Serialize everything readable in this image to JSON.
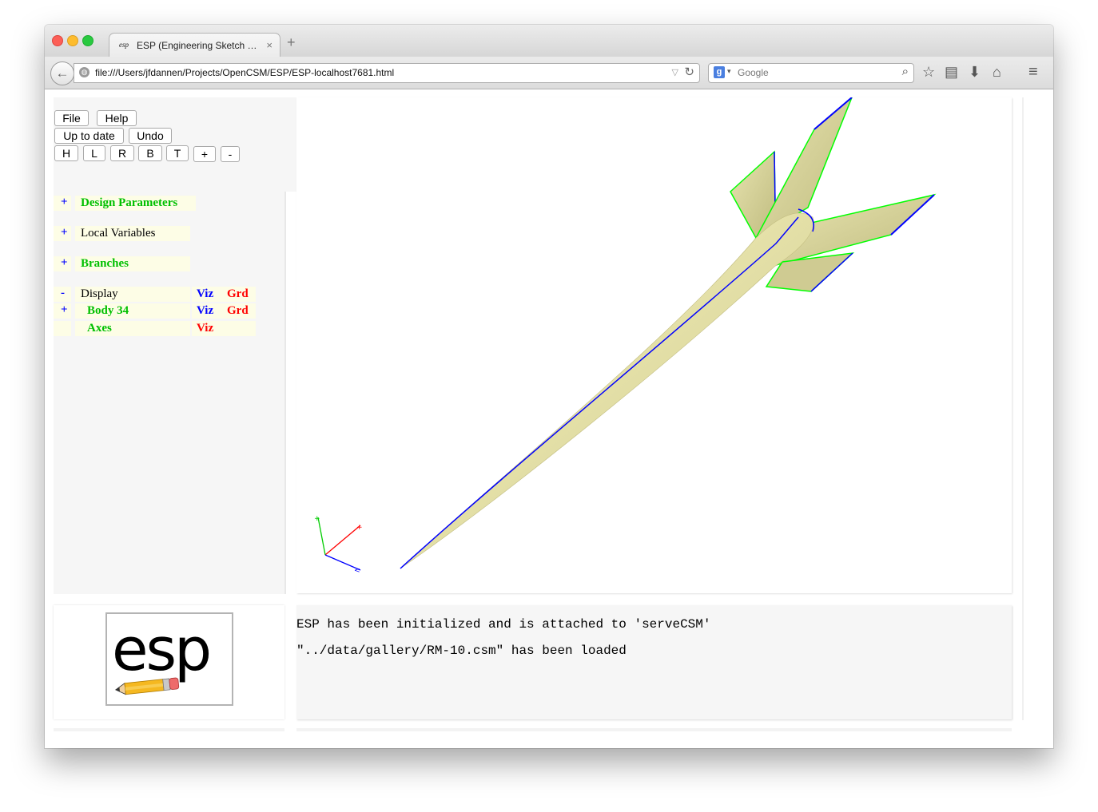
{
  "browser": {
    "tab_title": "ESP (Engineering Sketch Pa...",
    "tab_favicon": "esp",
    "url": "file:///Users/jfdannen/Projects/OpenCSM/ESP/ESP-localhost7681.html",
    "search_placeholder": "Google",
    "search_engine_letter": "g"
  },
  "toolbar": {
    "file": "File",
    "help": "Help",
    "up_to_date": "Up to date",
    "undo": "Undo",
    "view_h": "H",
    "view_l": "L",
    "view_r": "R",
    "view_b": "B",
    "view_t": "T",
    "zoom_in": "+",
    "zoom_out": "-"
  },
  "tree": {
    "design_parameters": {
      "sign": "+",
      "label": "Design Parameters"
    },
    "local_variables": {
      "sign": "+",
      "label": "Local Variables"
    },
    "branches": {
      "sign": "+",
      "label": "Branches"
    },
    "display": {
      "sign": "-",
      "label": "Display",
      "viz": "Viz",
      "grd": "Grd"
    },
    "body": {
      "sign": "+",
      "label": "Body 34",
      "viz": "Viz",
      "grd": "Grd"
    },
    "axes": {
      "label": "Axes",
      "viz": "Viz"
    }
  },
  "messages": [
    "ESP has been initialized and is attached to 'serveCSM'",
    "\"../data/gallery/RM-10.csm\" has been loaded"
  ],
  "logo": {
    "text": "esp"
  },
  "colors": {
    "body_fill": "#d8d49a",
    "edge_blue": "#0000ff",
    "edge_green": "#00ff00",
    "axis_x": "#ff0000",
    "axis_y": "#00cc00",
    "axis_z": "#0000ff"
  }
}
